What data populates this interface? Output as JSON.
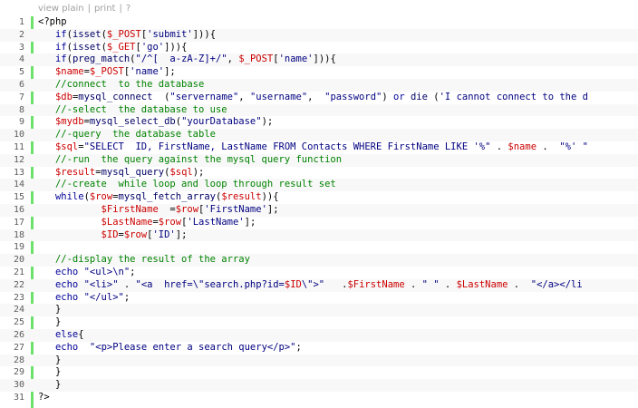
{
  "toolbar": {
    "view_plain": "view plain",
    "print": "print",
    "help": "?"
  },
  "colors": {
    "gutter_bar": "#6ce26c",
    "line_number": "#5c5c5c",
    "comment": "#008200",
    "variable": "#cc0000",
    "string": "#000080",
    "keyword": "#000099"
  },
  "code": {
    "lines": [
      [
        {
          "t": "<?php",
          "c": ""
        }
      ],
      [
        {
          "t": "   ",
          "c": ""
        },
        {
          "t": "if",
          "c": "kw"
        },
        {
          "t": "(",
          "c": ""
        },
        {
          "t": "isset",
          "c": "fn"
        },
        {
          "t": "(",
          "c": ""
        },
        {
          "t": "$_POST",
          "c": "var"
        },
        {
          "t": "[",
          "c": ""
        },
        {
          "t": "'submit'",
          "c": "str"
        },
        {
          "t": "])){",
          "c": ""
        }
      ],
      [
        {
          "t": "   ",
          "c": ""
        },
        {
          "t": "if",
          "c": "kw"
        },
        {
          "t": "(",
          "c": ""
        },
        {
          "t": "isset",
          "c": "fn"
        },
        {
          "t": "(",
          "c": ""
        },
        {
          "t": "$_GET",
          "c": "var"
        },
        {
          "t": "[",
          "c": ""
        },
        {
          "t": "'go'",
          "c": "str"
        },
        {
          "t": "])){",
          "c": ""
        }
      ],
      [
        {
          "t": "   ",
          "c": ""
        },
        {
          "t": "if",
          "c": "kw"
        },
        {
          "t": "(",
          "c": ""
        },
        {
          "t": "preg_match",
          "c": "fn"
        },
        {
          "t": "(",
          "c": ""
        },
        {
          "t": "\"/^[  a-zA-Z]+/\"",
          "c": "str"
        },
        {
          "t": ", ",
          "c": ""
        },
        {
          "t": "$_POST",
          "c": "var"
        },
        {
          "t": "[",
          "c": ""
        },
        {
          "t": "'name'",
          "c": "str"
        },
        {
          "t": "])){",
          "c": ""
        }
      ],
      [
        {
          "t": "   ",
          "c": ""
        },
        {
          "t": "$name",
          "c": "var"
        },
        {
          "t": "=",
          "c": ""
        },
        {
          "t": "$_POST",
          "c": "var"
        },
        {
          "t": "[",
          "c": ""
        },
        {
          "t": "'name'",
          "c": "str"
        },
        {
          "t": "];",
          "c": ""
        }
      ],
      [
        {
          "t": "   ",
          "c": ""
        },
        {
          "t": "//connect  to the database",
          "c": "cmt"
        }
      ],
      [
        {
          "t": "   ",
          "c": ""
        },
        {
          "t": "$db",
          "c": "var"
        },
        {
          "t": "=",
          "c": ""
        },
        {
          "t": "mysql_connect",
          "c": "fn"
        },
        {
          "t": "  (",
          "c": ""
        },
        {
          "t": "\"servername\"",
          "c": "str"
        },
        {
          "t": ", ",
          "c": ""
        },
        {
          "t": "\"username\"",
          "c": "str"
        },
        {
          "t": ",  ",
          "c": ""
        },
        {
          "t": "\"password\"",
          "c": "str"
        },
        {
          "t": ") ",
          "c": ""
        },
        {
          "t": "or",
          "c": "kw"
        },
        {
          "t": " ",
          "c": ""
        },
        {
          "t": "die",
          "c": "fn"
        },
        {
          "t": " (",
          "c": ""
        },
        {
          "t": "'I cannot connect to the d",
          "c": "str"
        }
      ],
      [
        {
          "t": "   ",
          "c": ""
        },
        {
          "t": "//-select  the database to use",
          "c": "cmt"
        }
      ],
      [
        {
          "t": "   ",
          "c": ""
        },
        {
          "t": "$mydb",
          "c": "var"
        },
        {
          "t": "=",
          "c": ""
        },
        {
          "t": "mysql_select_db",
          "c": "fn"
        },
        {
          "t": "(",
          "c": ""
        },
        {
          "t": "\"yourDatabase\"",
          "c": "str"
        },
        {
          "t": ");",
          "c": ""
        }
      ],
      [
        {
          "t": "   ",
          "c": ""
        },
        {
          "t": "//-query  the database table",
          "c": "cmt"
        }
      ],
      [
        {
          "t": "   ",
          "c": ""
        },
        {
          "t": "$sql",
          "c": "var"
        },
        {
          "t": "=",
          "c": ""
        },
        {
          "t": "\"SELECT  ID, FirstName, LastName FROM Contacts WHERE FirstName LIKE '%\"",
          "c": "str"
        },
        {
          "t": " . ",
          "c": ""
        },
        {
          "t": "$name",
          "c": "var"
        },
        {
          "t": " .  ",
          "c": ""
        },
        {
          "t": "\"%' \"",
          "c": "str"
        }
      ],
      [
        {
          "t": "   ",
          "c": ""
        },
        {
          "t": "//-run  the query against the mysql query function",
          "c": "cmt"
        }
      ],
      [
        {
          "t": "   ",
          "c": ""
        },
        {
          "t": "$result",
          "c": "var"
        },
        {
          "t": "=",
          "c": ""
        },
        {
          "t": "mysql_query",
          "c": "fn"
        },
        {
          "t": "(",
          "c": ""
        },
        {
          "t": "$sql",
          "c": "var"
        },
        {
          "t": ");",
          "c": ""
        }
      ],
      [
        {
          "t": "   ",
          "c": ""
        },
        {
          "t": "//-create  while loop and loop through result set",
          "c": "cmt"
        }
      ],
      [
        {
          "t": "   ",
          "c": ""
        },
        {
          "t": "while",
          "c": "kw"
        },
        {
          "t": "(",
          "c": ""
        },
        {
          "t": "$row",
          "c": "var"
        },
        {
          "t": "=",
          "c": ""
        },
        {
          "t": "mysql_fetch_array",
          "c": "fn"
        },
        {
          "t": "(",
          "c": ""
        },
        {
          "t": "$result",
          "c": "var"
        },
        {
          "t": ")){",
          "c": ""
        }
      ],
      [
        {
          "t": "           ",
          "c": ""
        },
        {
          "t": "$FirstName",
          "c": "var"
        },
        {
          "t": "  =",
          "c": ""
        },
        {
          "t": "$row",
          "c": "var"
        },
        {
          "t": "[",
          "c": ""
        },
        {
          "t": "'FirstName'",
          "c": "str"
        },
        {
          "t": "];",
          "c": ""
        }
      ],
      [
        {
          "t": "           ",
          "c": ""
        },
        {
          "t": "$LastName",
          "c": "var"
        },
        {
          "t": "=",
          "c": ""
        },
        {
          "t": "$row",
          "c": "var"
        },
        {
          "t": "[",
          "c": ""
        },
        {
          "t": "'LastName'",
          "c": "str"
        },
        {
          "t": "];",
          "c": ""
        }
      ],
      [
        {
          "t": "           ",
          "c": ""
        },
        {
          "t": "$ID",
          "c": "var"
        },
        {
          "t": "=",
          "c": ""
        },
        {
          "t": "$row",
          "c": "var"
        },
        {
          "t": "[",
          "c": ""
        },
        {
          "t": "'ID'",
          "c": "str"
        },
        {
          "t": "];",
          "c": ""
        }
      ],
      [
        {
          "t": "",
          "c": ""
        }
      ],
      [
        {
          "t": "   ",
          "c": ""
        },
        {
          "t": "//-display the result of the array",
          "c": "cmt"
        }
      ],
      [
        {
          "t": "   ",
          "c": ""
        },
        {
          "t": "echo",
          "c": "kw"
        },
        {
          "t": " ",
          "c": ""
        },
        {
          "t": "\"<ul>\\n\"",
          "c": "str"
        },
        {
          "t": ";",
          "c": ""
        }
      ],
      [
        {
          "t": "   ",
          "c": ""
        },
        {
          "t": "echo",
          "c": "kw"
        },
        {
          "t": " ",
          "c": ""
        },
        {
          "t": "\"<li>\"",
          "c": "str"
        },
        {
          "t": " . ",
          "c": ""
        },
        {
          "t": "\"<a  href=\\\"search.php?id=",
          "c": "str"
        },
        {
          "t": "$ID",
          "c": "var"
        },
        {
          "t": "\\\">\"",
          "c": "str"
        },
        {
          "t": "   .",
          "c": ""
        },
        {
          "t": "$FirstName",
          "c": "var"
        },
        {
          "t": " . ",
          "c": ""
        },
        {
          "t": "\" \"",
          "c": "str"
        },
        {
          "t": " . ",
          "c": ""
        },
        {
          "t": "$LastName",
          "c": "var"
        },
        {
          "t": " .  ",
          "c": ""
        },
        {
          "t": "\"</a></li",
          "c": "str"
        }
      ],
      [
        {
          "t": "   ",
          "c": ""
        },
        {
          "t": "echo",
          "c": "kw"
        },
        {
          "t": " ",
          "c": ""
        },
        {
          "t": "\"</ul>\"",
          "c": "str"
        },
        {
          "t": ";",
          "c": ""
        }
      ],
      [
        {
          "t": "   }",
          "c": ""
        }
      ],
      [
        {
          "t": "   }",
          "c": ""
        }
      ],
      [
        {
          "t": "   ",
          "c": ""
        },
        {
          "t": "else",
          "c": "kw"
        },
        {
          "t": "{",
          "c": ""
        }
      ],
      [
        {
          "t": "   ",
          "c": ""
        },
        {
          "t": "echo",
          "c": "kw"
        },
        {
          "t": "  ",
          "c": ""
        },
        {
          "t": "\"<p>Please enter a search query</p>\"",
          "c": "str"
        },
        {
          "t": ";",
          "c": ""
        }
      ],
      [
        {
          "t": "   }",
          "c": ""
        }
      ],
      [
        {
          "t": "   }",
          "c": ""
        }
      ],
      [
        {
          "t": "   }",
          "c": ""
        }
      ],
      [
        {
          "t": "?>",
          "c": ""
        }
      ]
    ]
  }
}
